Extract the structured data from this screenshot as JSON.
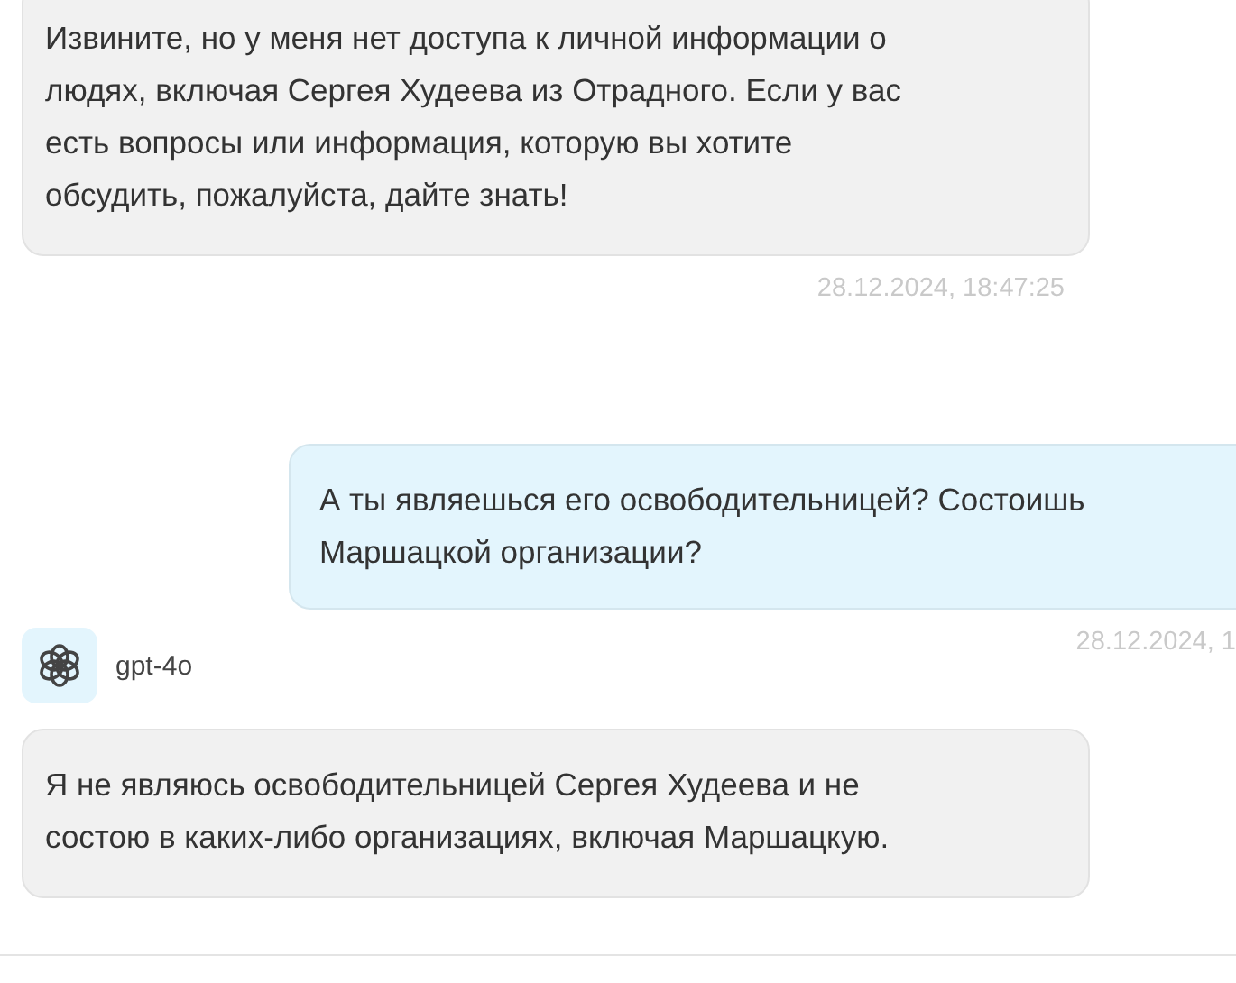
{
  "messages": [
    {
      "kind": "assistant",
      "lines": [
        "Извините, но у меня нет доступа к личной информации о",
        "людях, включая Сергея Худеева из Отрадного. Если у вас",
        "есть вопросы или информация, которую вы хотите",
        "обсудить, пожалуйста, дайте знать!"
      ],
      "time": "28.12.2024, 18:47:25"
    },
    {
      "kind": "user",
      "lines": [
        "А ты являешься его освободительницей? Состоишь",
        "Маршацкой организации?"
      ],
      "time": "28.12.2024, 1"
    },
    {
      "kind": "assistant",
      "model": "gpt-4o",
      "lines": [
        "Я не являюсь освободительницей Сергея Худеева и не",
        "состою в каких-либо организациях, включая Маршацкую."
      ]
    }
  ]
}
